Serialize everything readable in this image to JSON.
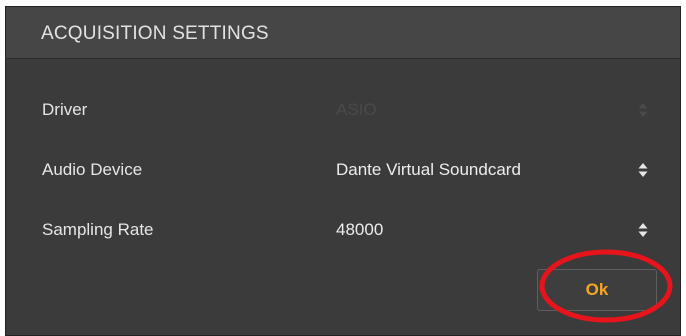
{
  "dialog": {
    "title": "ACQUISITION SETTINGS",
    "rows": [
      {
        "label": "Driver",
        "value": "ASIO",
        "disabled": true
      },
      {
        "label": "Audio Device",
        "value": "Dante Virtual Soundcard",
        "disabled": false
      },
      {
        "label": "Sampling Rate",
        "value": "48000",
        "disabled": false
      }
    ],
    "ok_label": "Ok"
  },
  "icons": {
    "select_arrows": "sort-updown-icon"
  },
  "colors": {
    "dialog_bg": "#3b3b3b",
    "header_bg": "#464646",
    "ok_text": "#f5a623",
    "annotation": "#e8141c"
  }
}
